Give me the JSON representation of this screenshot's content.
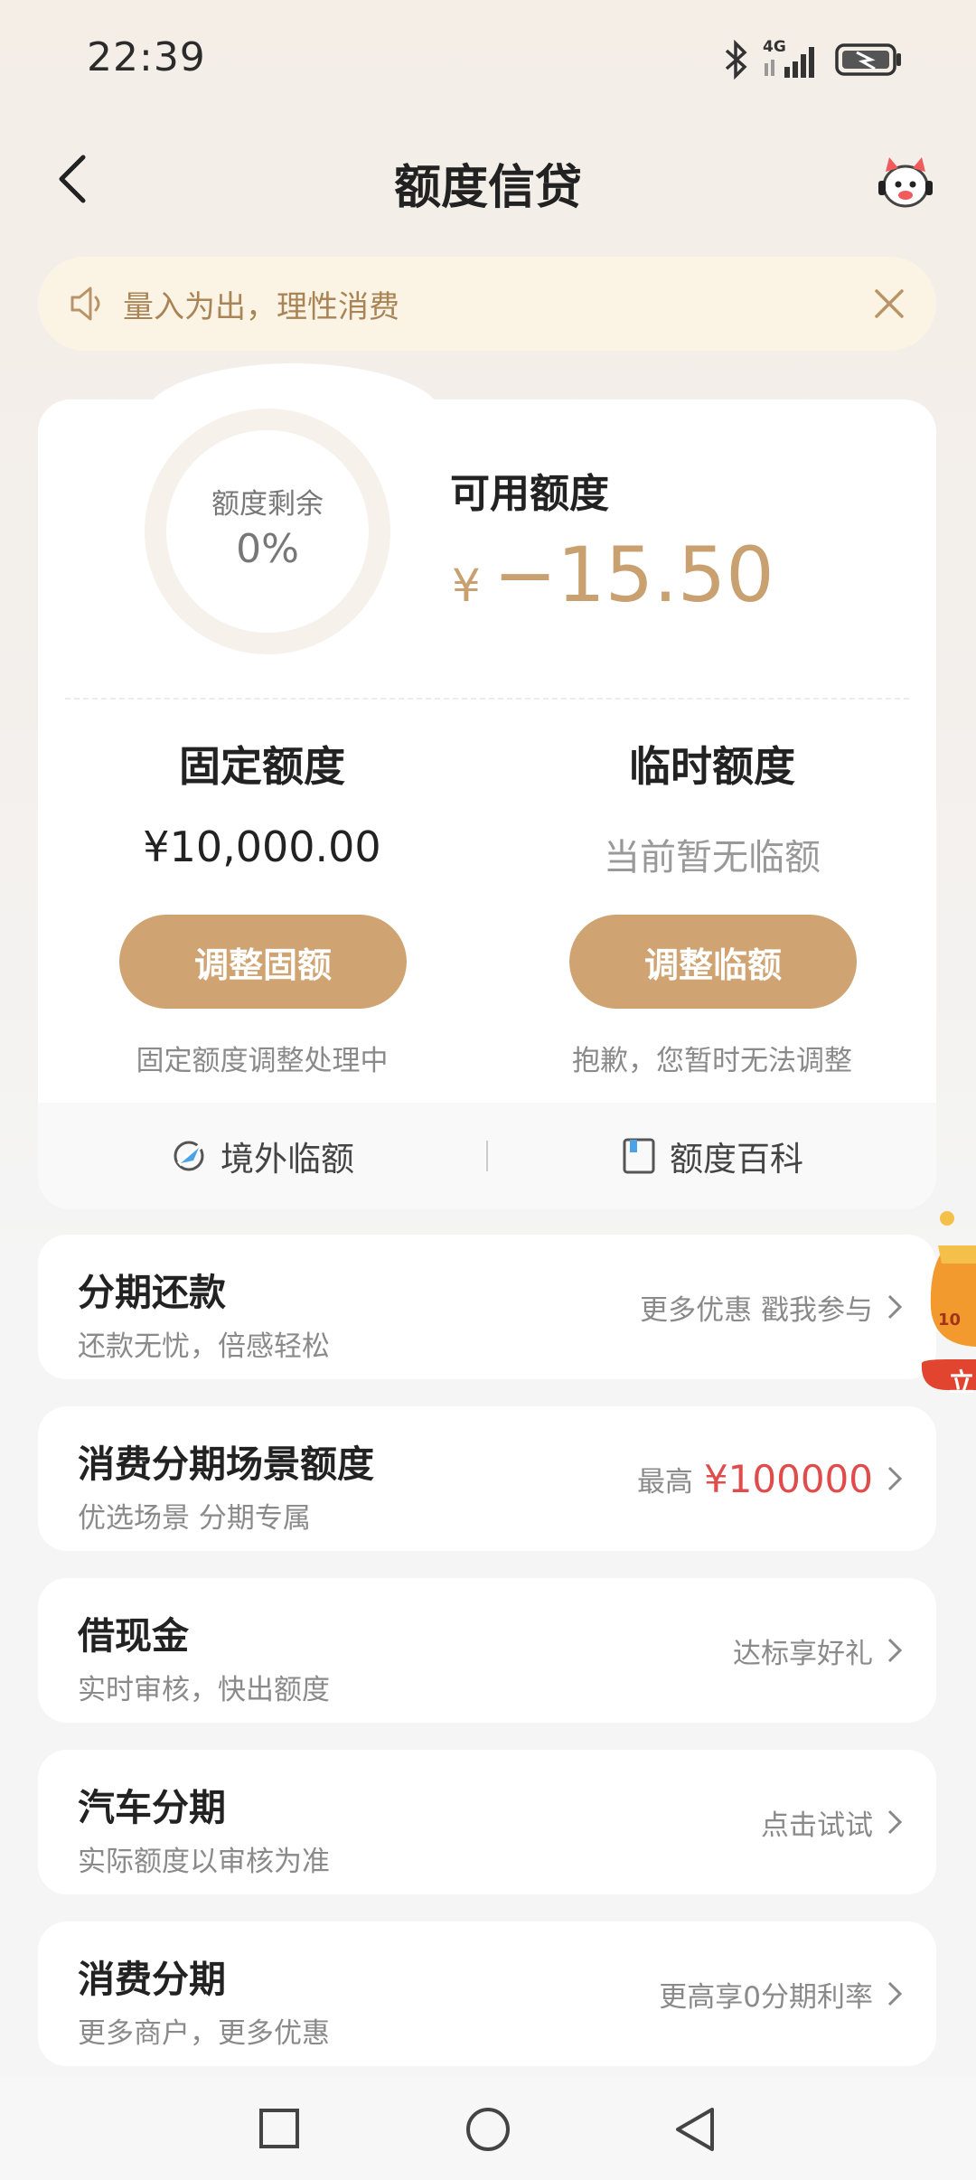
{
  "status": {
    "time": "22:39",
    "network": "4G"
  },
  "header": {
    "title": "额度信贷",
    "back_icon": "back-arrow-icon",
    "service_icon": "customer-service-icon"
  },
  "notice": {
    "text": "量入为出，理性消费"
  },
  "credit": {
    "ring_label": "额度剩余",
    "ring_value": "0%",
    "remaining_fraction": 0,
    "available_label": "可用额度",
    "currency": "¥",
    "available_amount": "−15.50",
    "fixed": {
      "title": "固定额度",
      "value": "¥10,000.00",
      "button": "调整固额",
      "note": "固定额度调整处理中"
    },
    "temp": {
      "title": "临时额度",
      "value": "当前暂无临额",
      "button": "调整临额",
      "note": "抱歉，您暂时无法调整"
    },
    "footer": {
      "overseas": "境外临额",
      "wiki": "额度百科"
    }
  },
  "list": [
    {
      "title": "分期还款",
      "subtitle": "还款无忧，倍感轻松",
      "right": "更多优惠 戳我参与"
    },
    {
      "title": "消费分期场景额度",
      "subtitle": "优选场景 分期专属",
      "right_prefix": "最高",
      "right_highlight": "¥100000"
    },
    {
      "title": "借现金",
      "subtitle": "实时审核，快出额度",
      "right": "达标享好礼"
    },
    {
      "title": "汽车分期",
      "subtitle": "实际额度以审核为准",
      "right": "点击试试"
    },
    {
      "title": "消费分期",
      "subtitle": "更多商户，更多优惠",
      "right": "更高享0分期利率"
    }
  ],
  "promo": {
    "text_top": "10",
    "text_bottom": "立"
  },
  "colors": {
    "accent": "#cfa372",
    "amount": "#c9a070",
    "notice_bg": "#fbf4e5",
    "highlight": "#e04b4b"
  }
}
